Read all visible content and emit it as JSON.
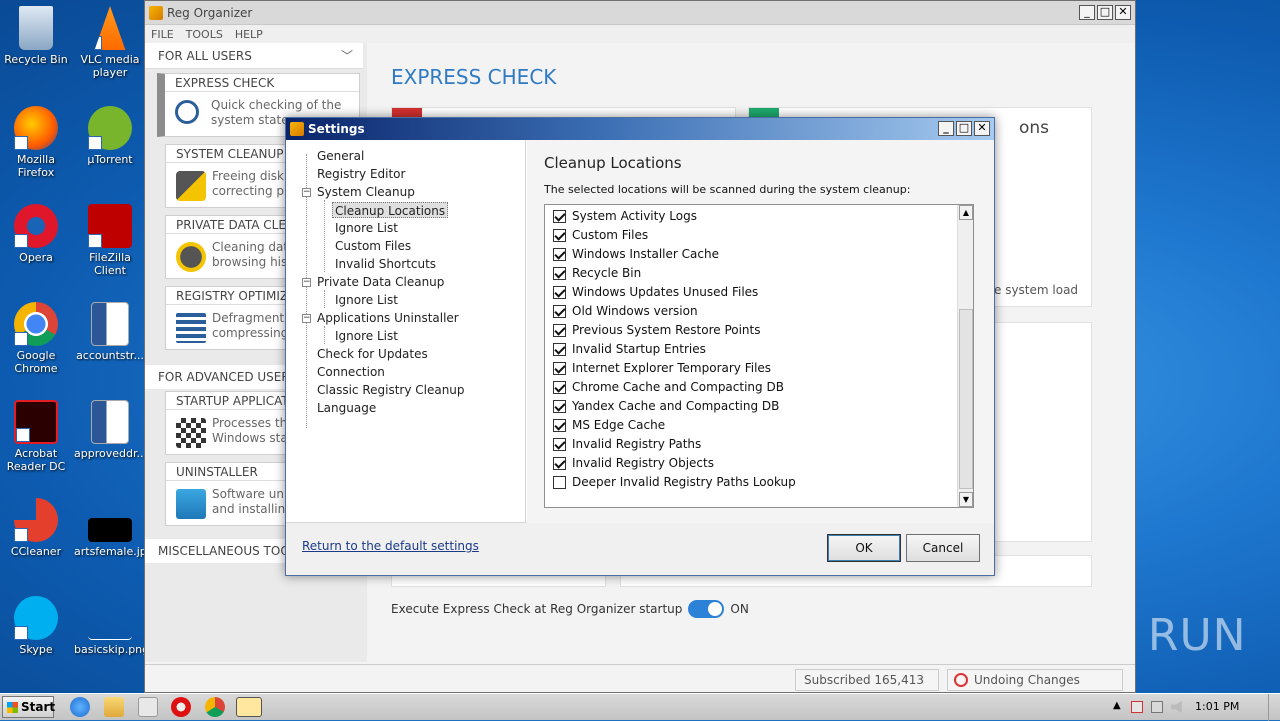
{
  "desktop": {
    "icons": [
      {
        "label": "Recycle Bin"
      },
      {
        "label": "VLC media player"
      },
      {
        "label": "Mozilla Firefox"
      },
      {
        "label": "µTorrent"
      },
      {
        "label": "Opera"
      },
      {
        "label": "FileZilla Client"
      },
      {
        "label": "Google Chrome"
      },
      {
        "label": "accountstr..."
      },
      {
        "label": "Acrobat Reader DC"
      },
      {
        "label": "approveddr..."
      },
      {
        "label": "CCleaner"
      },
      {
        "label": "artsfemale.jpg"
      },
      {
        "label": "Skype"
      },
      {
        "label": "basicskip.png"
      }
    ],
    "watermark": "ANY RUN"
  },
  "main_window": {
    "title": "Reg Organizer",
    "menu": [
      "FILE",
      "TOOLS",
      "HELP"
    ],
    "for_all_users": "FOR ALL USERS",
    "sections": [
      {
        "title": "EXPRESS CHECK",
        "desc": "Quick checking of the\nsystem state"
      },
      {
        "title": "SYSTEM CLEANUP",
        "desc": "Freeing disk s\ncorrecting pro"
      },
      {
        "title": "PRIVATE DATA CLEA",
        "desc": "Cleaning data\nbrowsing hist"
      },
      {
        "title": "REGISTRY OPTIMIZA",
        "desc": "Defragmentin\ncompressing"
      },
      {
        "title": "STARTUP APPLICATI",
        "desc": "Processes tha\nWindows star"
      },
      {
        "title": "UNINSTALLER",
        "desc": "Software unin\nand installing"
      }
    ],
    "for_advanced_users": "FOR ADVANCED USERS",
    "miscellaneous": "MISCELLANEOUS TOOL",
    "express_check_title": "EXPRESS CHECK",
    "card_partial_text": "ons",
    "card_partial_text2": "e system load",
    "express_startup_label": "Execute Express Check at Reg Organizer startup",
    "express_startup_state": "ON",
    "subscribed": "Subscribed 165,413",
    "undo_center": "Undoing Changes Center",
    "colors": {
      "accent": "#2f7ac4",
      "red_tile": "#d32f2f",
      "green_tile": "#1eaa6e"
    }
  },
  "settings": {
    "title": "Settings",
    "tree": [
      {
        "label": "General"
      },
      {
        "label": "Registry Editor"
      },
      {
        "label": "System Cleanup"
      },
      {
        "label": "Cleanup Locations"
      },
      {
        "label": "Ignore List"
      },
      {
        "label": "Custom Files"
      },
      {
        "label": "Invalid Shortcuts"
      },
      {
        "label": "Private Data Cleanup"
      },
      {
        "label": "Ignore List"
      },
      {
        "label": "Applications Uninstaller"
      },
      {
        "label": "Ignore List"
      },
      {
        "label": "Check for Updates"
      },
      {
        "label": "Connection"
      },
      {
        "label": "Classic Registry Cleanup"
      },
      {
        "label": "Language"
      }
    ],
    "pane_title": "Cleanup Locations",
    "pane_desc": "The selected locations will be scanned during the system cleanup:",
    "locations": [
      {
        "label": "System Activity Logs",
        "checked": true
      },
      {
        "label": "Custom Files",
        "checked": true
      },
      {
        "label": "Windows Installer Cache",
        "checked": true
      },
      {
        "label": "Recycle Bin",
        "checked": true
      },
      {
        "label": "Windows Updates Unused Files",
        "checked": true
      },
      {
        "label": "Old Windows version",
        "checked": true
      },
      {
        "label": "Previous System Restore Points",
        "checked": true
      },
      {
        "label": "Invalid Startup Entries",
        "checked": true
      },
      {
        "label": "Internet Explorer Temporary Files",
        "checked": true
      },
      {
        "label": "Chrome Cache and Compacting DB",
        "checked": true
      },
      {
        "label": "Yandex Cache and Compacting DB",
        "checked": true
      },
      {
        "label": "MS Edge Cache",
        "checked": true
      },
      {
        "label": "Invalid Registry Paths",
        "checked": true
      },
      {
        "label": "Invalid Registry Objects",
        "checked": true
      },
      {
        "label": "Deeper Invalid Registry Paths Lookup",
        "checked": false
      }
    ],
    "reset_link": "Return to the default settings",
    "ok_label": "OK",
    "cancel_label": "Cancel"
  },
  "taskbar": {
    "start_label": "Start",
    "clock": "1:01 PM"
  }
}
